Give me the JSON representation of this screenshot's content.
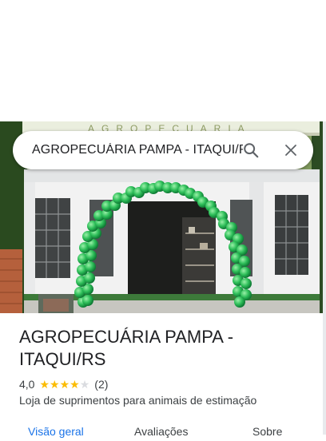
{
  "search": {
    "query": "AGROPECUÁRIA PAMPA - ITAQUI/RS"
  },
  "photo": {
    "sign_text": "AGROPECUARIA"
  },
  "place": {
    "name": "AGROPECUÁRIA PAMPA - ITAQUI/RS",
    "rating": "4,0",
    "rating_stars": 4,
    "rating_max": 5,
    "review_count": "(2)",
    "category": "Loja de suprimentos para animais de estimação"
  },
  "tabs": [
    {
      "label": "Visão geral",
      "active": true
    },
    {
      "label": "Avaliações",
      "active": false
    },
    {
      "label": "Sobre",
      "active": false
    }
  ],
  "colors": {
    "accent": "#1a73e8",
    "star": "#fbbc04",
    "balloons": "#2fbf5a"
  },
  "icons": {
    "search": "search-icon",
    "close": "close-icon",
    "star": "star-icon"
  }
}
